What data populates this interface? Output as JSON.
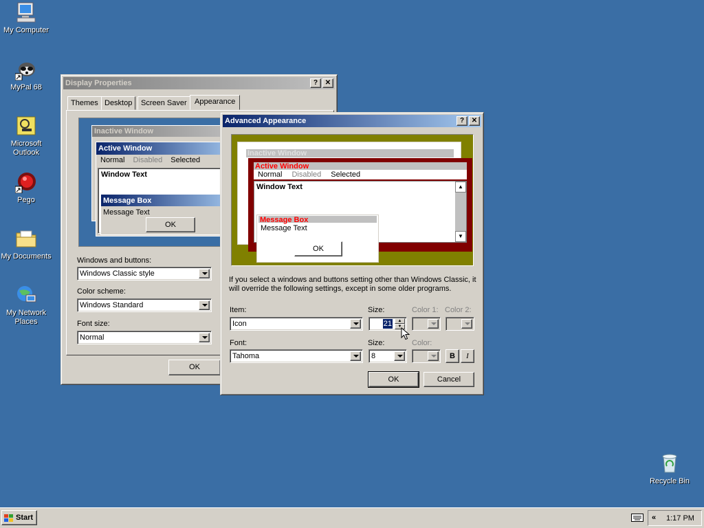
{
  "desktop": {
    "icons": [
      {
        "label": "My Computer",
        "icon": "computer-icon"
      },
      {
        "label": "MyPal 68",
        "icon": "raccoon-icon"
      },
      {
        "label": "Microsoft Outlook",
        "icon": "outlook-icon"
      },
      {
        "label": "Pego",
        "icon": "red-ball-icon"
      },
      {
        "label": "My Documents",
        "icon": "folder-icon"
      },
      {
        "label": "My Network Places",
        "icon": "network-icon"
      },
      {
        "label": "Recycle Bin",
        "icon": "recycle-bin-icon"
      }
    ]
  },
  "display_properties": {
    "title": "Display Properties",
    "tabs": [
      "Themes",
      "Desktop",
      "Screen Saver",
      "Appearance"
    ],
    "selected_tab": "Appearance",
    "preview": {
      "inactive_title": "Inactive Window",
      "active_title": "Active Window",
      "menu": [
        "Normal",
        "Disabled",
        "Selected"
      ],
      "window_text": "Window Text",
      "message_box_title": "Message Box",
      "message_text": "Message Text",
      "ok": "OK"
    },
    "windows_buttons_label": "Windows and buttons:",
    "windows_buttons_value": "Windows Classic style",
    "color_scheme_label": "Color scheme:",
    "color_scheme_value": "Windows Standard",
    "font_size_label": "Font size:",
    "font_size_value": "Normal",
    "ok": "OK"
  },
  "advanced_appearance": {
    "title": "Advanced Appearance",
    "preview": {
      "inactive_title": "Inactive Window",
      "active_title": "Active Window",
      "menu": [
        "Normal",
        "Disabled",
        "Selected"
      ],
      "window_text": "Window Text",
      "message_box_title": "Message Box",
      "message_text": "Message Text",
      "ok": "OK"
    },
    "info_text": "If you select a windows and buttons setting other than Windows Classic, it will override the following settings, except in some older programs.",
    "item_label": "Item:",
    "item_value": "Icon",
    "size_label": "Size:",
    "size_value": "21",
    "color1_label": "Color 1:",
    "color2_label": "Color 2:",
    "font_label": "Font:",
    "font_value": "Tahoma",
    "font_size_label": "Size:",
    "font_size_value": "8",
    "color_label": "Color:",
    "bold": "B",
    "italic": "I",
    "ok": "OK",
    "cancel": "Cancel"
  },
  "taskbar": {
    "start": "Start",
    "tray_expand": "«",
    "clock": "1:17 PM"
  },
  "colors": {
    "desktop": "#3a6ea5",
    "active_title": "#0a246a",
    "preview_bg_olive": "#808000",
    "preview_maroon": "#800000",
    "preview_red_text": "#ff0000"
  }
}
